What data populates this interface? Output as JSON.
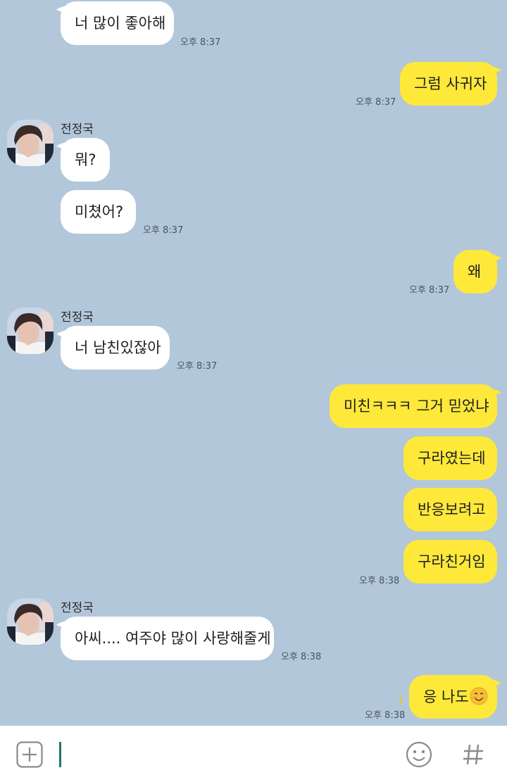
{
  "contact": {
    "name": "전정국"
  },
  "messages": [
    {
      "side": "in",
      "text": "너 많이 좋아해",
      "time": "오후 8:37"
    },
    {
      "side": "out",
      "text": "그럼 사귀자",
      "time": "오후 8:37"
    },
    {
      "side": "in",
      "sender": "전정국",
      "text": "뭐?"
    },
    {
      "side": "in",
      "text": "미쳤어?",
      "time": "오후 8:37"
    },
    {
      "side": "out",
      "text": "왜",
      "time": "오후 8:37"
    },
    {
      "side": "in",
      "sender": "전정국",
      "text": "너 남친있잖아",
      "time": "오후 8:37"
    },
    {
      "side": "out",
      "text": "미친ㅋㅋㅋ 그거 믿었냐"
    },
    {
      "side": "out",
      "text": "구라였는데"
    },
    {
      "side": "out",
      "text": "반응보려고"
    },
    {
      "side": "out",
      "text": "구라친거임",
      "time": "오후 8:38"
    },
    {
      "side": "in",
      "sender": "전정국",
      "text": "아씨.... 여주야 많이 사랑해줄게",
      "time": "오후 8:38"
    },
    {
      "side": "out",
      "text": "응 나도",
      "emoji": "smiling-face-emoji",
      "time": "오후 8:38",
      "unread": "1"
    }
  ],
  "input": {
    "value": ""
  },
  "colors": {
    "background": "#b2c7da",
    "outgoing": "#fee83a",
    "incoming": "#ffffff",
    "cursor": "#1a7a6a"
  }
}
